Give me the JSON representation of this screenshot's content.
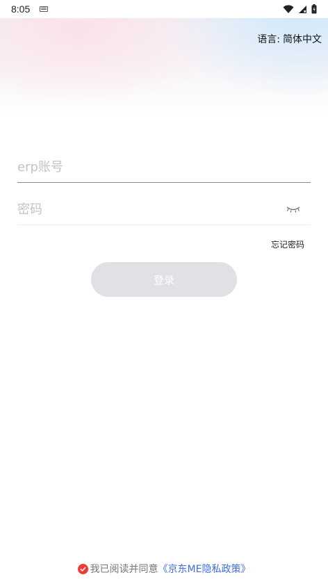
{
  "status_bar": {
    "time": "8:05",
    "icons": [
      "keyboard-icon",
      "wifi-icon",
      "signal-icon",
      "battery-icon"
    ]
  },
  "header": {
    "language_label": "语言:",
    "language_value": "简体中文"
  },
  "form": {
    "username_placeholder": "erp账号",
    "username_value": "",
    "password_placeholder": "密码",
    "password_value": "",
    "password_toggle_icon": "eye-closed-icon",
    "forgot_password": "忘记密码",
    "login_label": "登录"
  },
  "agreement": {
    "text": "我已阅读并同意",
    "policy_link": "《京东ME隐私政策》",
    "checked": true
  },
  "colors": {
    "accent_link": "#3d6ee6",
    "check_red": "#f03a34",
    "button_disabled": "#dfe1e4"
  }
}
